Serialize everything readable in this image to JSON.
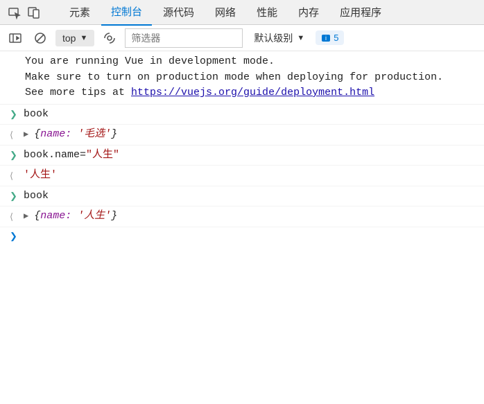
{
  "tabs": {
    "elements": "元素",
    "console": "控制台",
    "sources": "源代码",
    "network": "网络",
    "performance": "性能",
    "memory": "内存",
    "application": "应用程序"
  },
  "toolbar": {
    "context": "top",
    "filter_placeholder": "筛选器",
    "default_level": "默认级别",
    "issue_count": "5"
  },
  "console_msg": {
    "line1": "You are running Vue in development mode.",
    "line2": "Make sure to turn on production mode when deploying for production.",
    "line3_prefix": "See more tips at ",
    "line3_url": "https://vuejs.org/guide/deployment.html"
  },
  "entries": {
    "cmd1": "book",
    "res1_key": "name:",
    "res1_val": "'毛选'",
    "cmd2_lhs": "book.name=",
    "cmd2_rhs": "\"人生\"",
    "res2": "'人生'",
    "cmd3": "book",
    "res3_key": "name:",
    "res3_val": "'人生'"
  }
}
